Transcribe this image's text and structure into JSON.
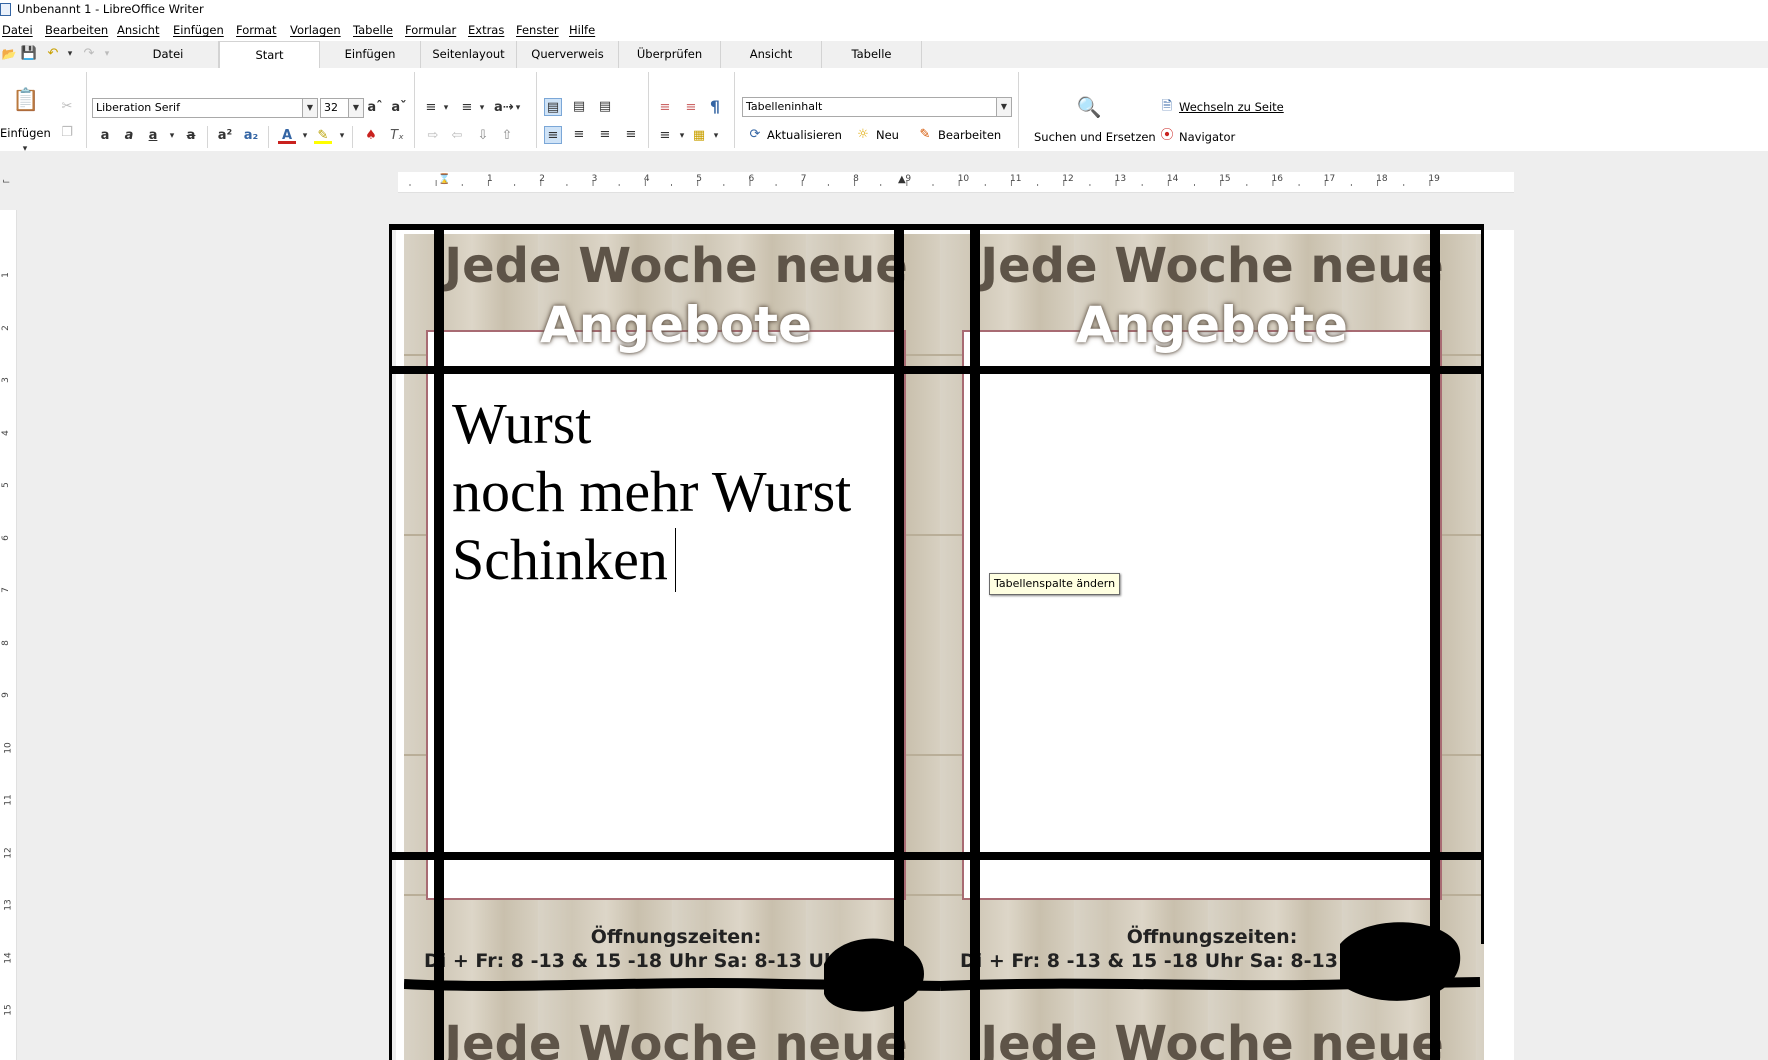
{
  "window": {
    "title": "Unbenannt 1 - LibreOffice Writer"
  },
  "menu": [
    "Datei",
    "Bearbeiten",
    "Ansicht",
    "Einfügen",
    "Format",
    "Vorlagen",
    "Tabelle",
    "Formular",
    "Extras",
    "Fenster",
    "Hilfe"
  ],
  "tabs": [
    "Datei",
    "Start",
    "Einfügen",
    "Seitenlayout",
    "Querverweis",
    "Überprüfen",
    "Ansicht",
    "Tabelle"
  ],
  "active_tab": "Start",
  "ribbon": {
    "paste_label": "Einfügen",
    "font_name": "Liberation Serif",
    "font_size": "32",
    "paragraph_style": "Tabelleninhalt",
    "update_label": "Aktualisieren",
    "new_label": "Neu",
    "edit_label": "Bearbeiten",
    "find_replace_label": "Suchen und Ersetzen",
    "goto_page_label": "Wechseln zu Seite",
    "navigator_label": "Navigator"
  },
  "ruler": {
    "h_labels": [
      "1",
      "2",
      "3",
      "4",
      "5",
      "6",
      "7",
      "8",
      "9",
      "10",
      "11",
      "12",
      "13",
      "14",
      "15",
      "16",
      "17",
      "18",
      "19"
    ],
    "v_labels": [
      "1",
      "2",
      "3",
      "4",
      "5",
      "6",
      "7",
      "8",
      "9",
      "10",
      "11",
      "12",
      "13",
      "14",
      "15"
    ]
  },
  "poster": {
    "headline_top": "Jede Woche neue",
    "headline_bottom": "Angebote",
    "hours_title": "Öffnungszeiten:",
    "hours_line": "Di + Fr: 8 -13 & 15 -18 Uhr  Sa: 8-13 Uhr"
  },
  "document": {
    "lines": [
      "Wurst",
      "noch mehr Wurst",
      "Schinken"
    ]
  },
  "tooltip": "Tabellenspalte ändern"
}
